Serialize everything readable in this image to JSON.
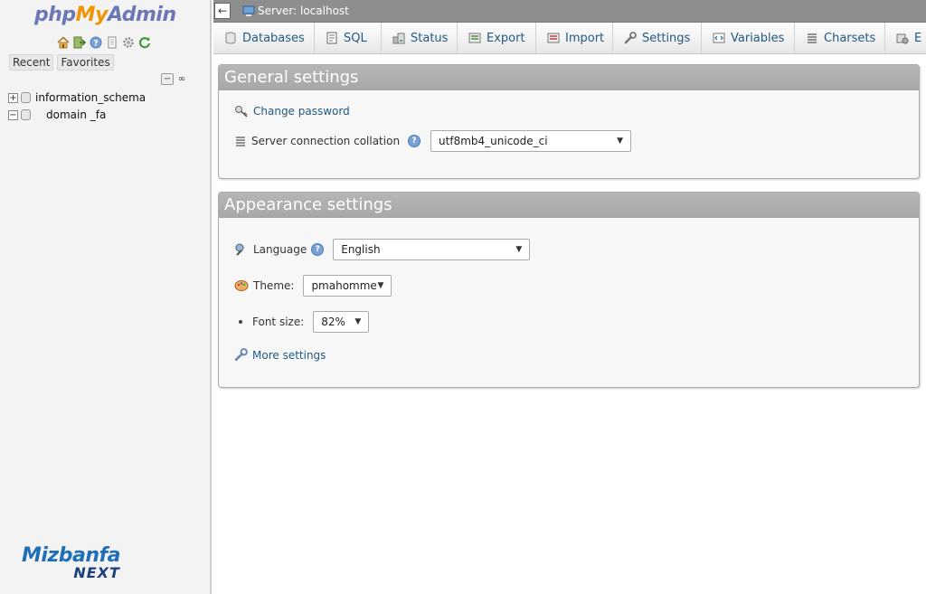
{
  "nav": {
    "logo": {
      "part1": "php",
      "part2": "My",
      "part3": "Admin"
    },
    "icons": [
      "home-icon",
      "logout-icon",
      "help-icon",
      "docs-icon",
      "settings-icon",
      "reload-icon"
    ],
    "links": {
      "recent": "Recent",
      "favorites": "Favorites"
    },
    "tools": {
      "collapse": "−",
      "link": "∞"
    },
    "tree": [
      {
        "label": "information_schema",
        "expander": "+"
      },
      {
        "label": "domain _fa",
        "expander": "−"
      }
    ],
    "brand": {
      "line1": "Mizbanfa",
      "line2": "NEXT"
    }
  },
  "topbar": {
    "collapse": "←",
    "server": "Server: localhost"
  },
  "tabs": [
    {
      "label": "Databases",
      "icon": "database-icon"
    },
    {
      "label": "SQL",
      "icon": "sql-icon"
    },
    {
      "label": "Status",
      "icon": "status-icon"
    },
    {
      "label": "Export",
      "icon": "export-icon"
    },
    {
      "label": "Import",
      "icon": "import-icon"
    },
    {
      "label": "Settings",
      "icon": "wrench-icon"
    },
    {
      "label": "Variables",
      "icon": "variables-icon"
    },
    {
      "label": "Charsets",
      "icon": "charsets-icon"
    },
    {
      "label": "E",
      "icon": "engines-icon"
    }
  ],
  "general": {
    "title": "General settings",
    "change_password": "Change password",
    "collation_label": "Server connection collation",
    "collation_value": "utf8mb4_unicode_ci"
  },
  "appearance": {
    "title": "Appearance settings",
    "language_label": "Language",
    "language_value": "English",
    "theme_label": "Theme:",
    "theme_value": "pmahomme",
    "fontsize_label": "Font size:",
    "fontsize_value": "82%",
    "more_settings": "More settings"
  },
  "colors": {
    "link": "#235a81",
    "panel_header": "#aaaaaa",
    "logo_blue": "#6c78b5",
    "logo_orange": "#f29400"
  }
}
